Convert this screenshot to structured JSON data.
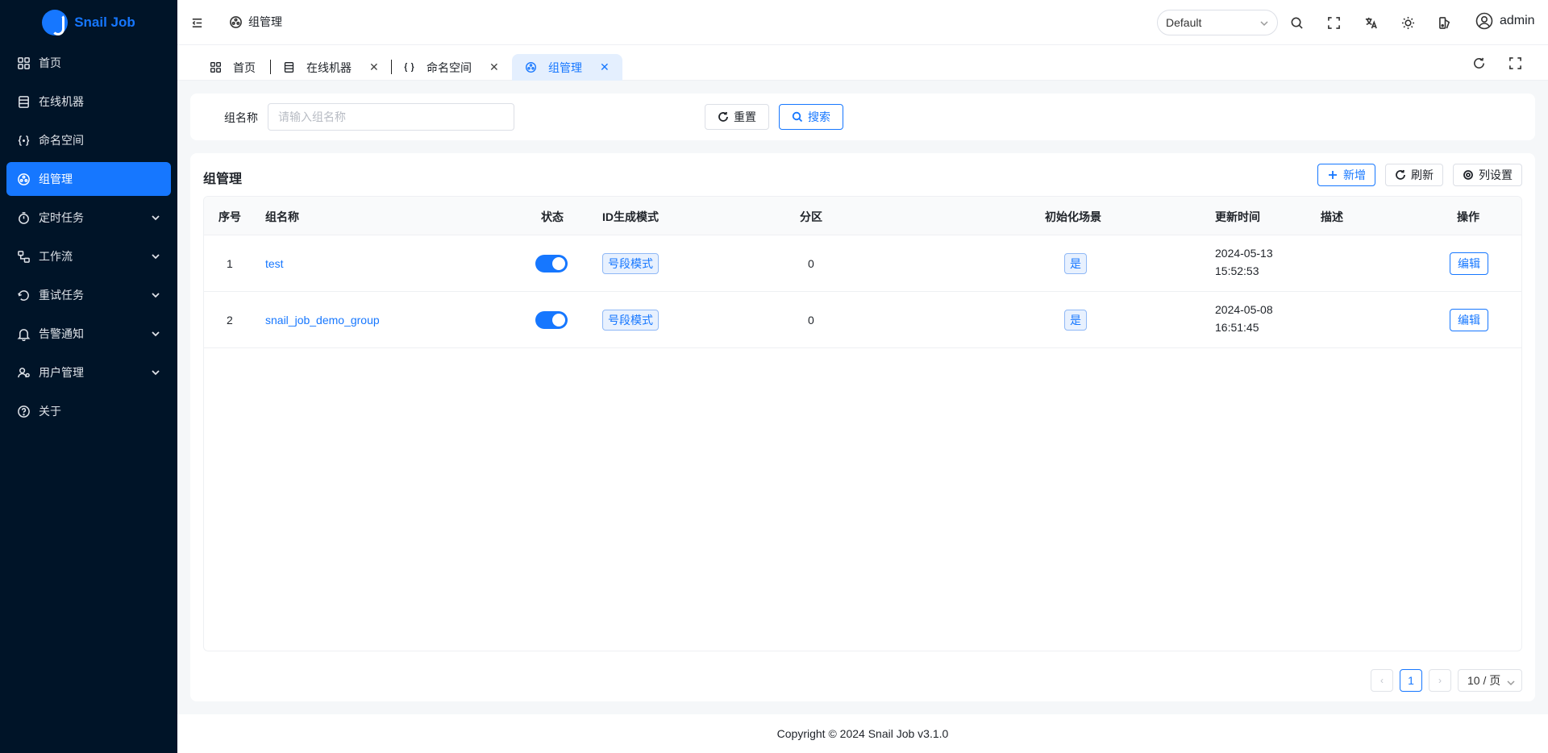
{
  "app": {
    "name": "Snail Job"
  },
  "sidebar": {
    "items": [
      {
        "label": "首页",
        "icon": "dashboard-icon"
      },
      {
        "label": "在线机器",
        "icon": "server-icon"
      },
      {
        "label": "命名空间",
        "icon": "braces-icon"
      },
      {
        "label": "组管理",
        "icon": "group-icon",
        "active": true
      },
      {
        "label": "定时任务",
        "icon": "timer-icon",
        "expandable": true
      },
      {
        "label": "工作流",
        "icon": "workflow-icon",
        "expandable": true
      },
      {
        "label": "重试任务",
        "icon": "retry-icon",
        "expandable": true
      },
      {
        "label": "告警通知",
        "icon": "bell-icon",
        "expandable": true
      },
      {
        "label": "用户管理",
        "icon": "users-icon",
        "expandable": true
      },
      {
        "label": "关于",
        "icon": "help-icon"
      }
    ]
  },
  "header": {
    "breadcrumb": "组管理",
    "theme_select": "Default",
    "user": "admin"
  },
  "tabs": [
    {
      "label": "首页"
    },
    {
      "label": "在线机器"
    },
    {
      "label": "命名空间"
    },
    {
      "label": "组管理",
      "active": true
    }
  ],
  "search": {
    "label": "组名称",
    "placeholder": "请输入组名称",
    "reset_label": "重置",
    "search_label": "搜索"
  },
  "table_card": {
    "title": "组管理",
    "add_label": "新增",
    "refresh_label": "刷新",
    "columns_label": "列设置"
  },
  "table": {
    "columns": [
      "序号",
      "组名称",
      "状态",
      "ID生成模式",
      "分区",
      "初始化场景",
      "更新时间",
      "描述",
      "操作"
    ],
    "rows": [
      {
        "index": "1",
        "name": "test",
        "status": true,
        "id_mode": "号段模式",
        "partition": "0",
        "init_scene": "是",
        "updated_date": "2024-05-13",
        "updated_time": "15:52:53",
        "description": "",
        "action": "编辑"
      },
      {
        "index": "2",
        "name": "snail_job_demo_group",
        "status": true,
        "id_mode": "号段模式",
        "partition": "0",
        "init_scene": "是",
        "updated_date": "2024-05-08",
        "updated_time": "16:51:45",
        "description": "",
        "action": "编辑"
      }
    ]
  },
  "pagination": {
    "current_page": "1",
    "page_size": "10 / 页"
  },
  "footer": {
    "copyright": "Copyright © 2024 Snail Job v3.1.0"
  },
  "colors": {
    "primary": "#1677ff",
    "sidebar_bg": "#001428"
  }
}
